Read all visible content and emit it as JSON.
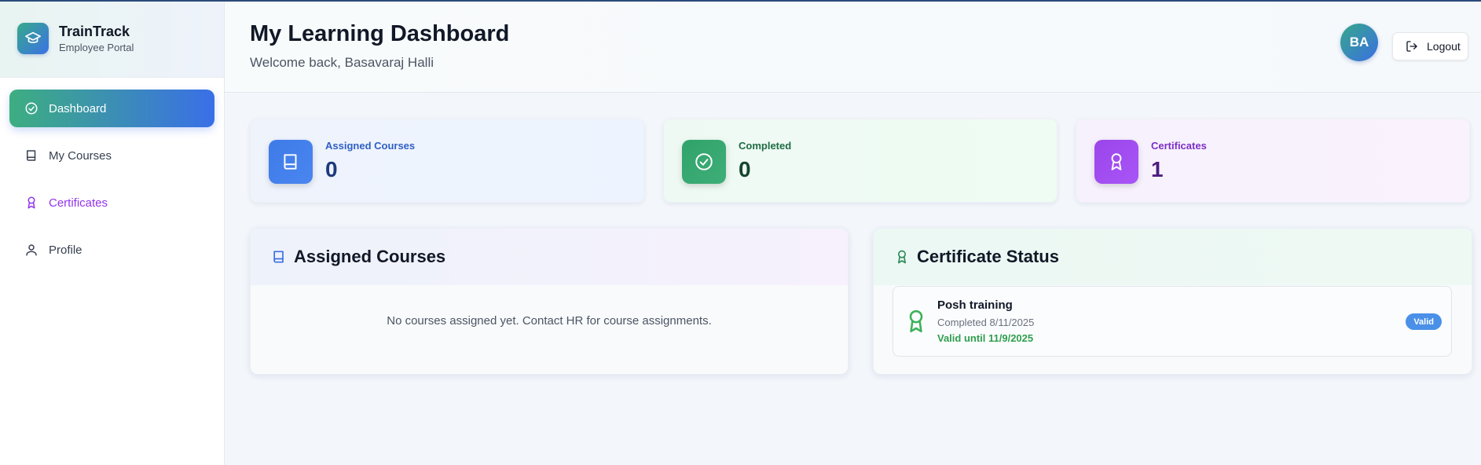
{
  "brand": {
    "name": "TrainTrack",
    "subtitle": "Employee Portal"
  },
  "sidebar": {
    "items": [
      {
        "label": "Dashboard",
        "icon": "check-circle-icon",
        "active": true
      },
      {
        "label": "My Courses",
        "icon": "book-icon"
      },
      {
        "label": "Certificates",
        "icon": "award-icon"
      },
      {
        "label": "Profile",
        "icon": "user-icon"
      }
    ]
  },
  "header": {
    "title": "My Learning Dashboard",
    "welcome": "Welcome back, Basavaraj Halli",
    "avatar_initials": "BA",
    "logout_label": "Logout"
  },
  "stats": [
    {
      "label": "Assigned Courses",
      "value": "0",
      "icon": "book-icon"
    },
    {
      "label": "Completed",
      "value": "0",
      "icon": "check-circle-icon"
    },
    {
      "label": "Certificates",
      "value": "1",
      "icon": "award-icon"
    }
  ],
  "assigned_courses": {
    "title": "Assigned Courses",
    "empty_message": "No courses assigned yet. Contact HR for course assignments."
  },
  "certificate_status": {
    "title": "Certificate Status",
    "items": [
      {
        "name": "Posh training",
        "completed": "Completed 8/11/2025",
        "valid_until": "Valid until 11/9/2025",
        "badge": "Valid"
      }
    ]
  },
  "colors": {
    "accent_green": "#3dae80",
    "accent_blue": "#3a6fe8",
    "purple": "#9333ea",
    "valid_green": "#2f9e4f",
    "badge_blue": "#4a90e8"
  }
}
